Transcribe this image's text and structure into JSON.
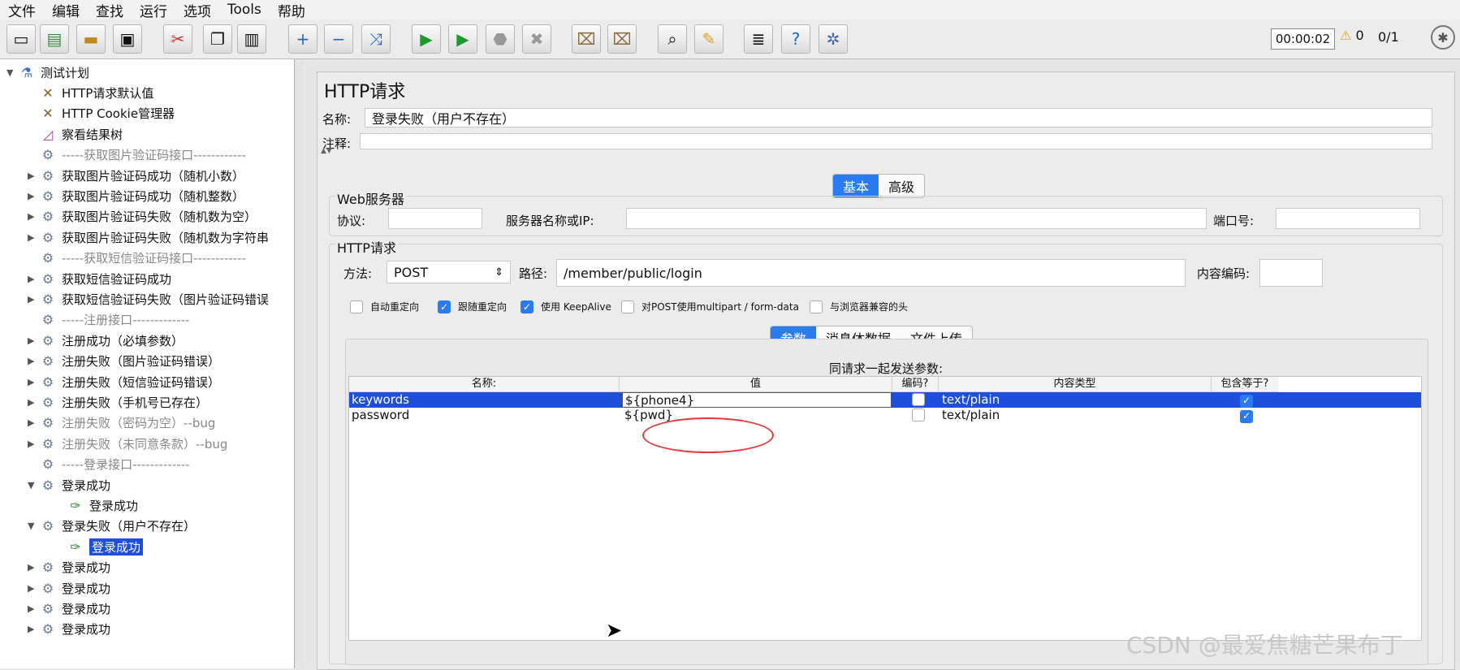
{
  "menu": [
    "文件",
    "编辑",
    "查找",
    "运行",
    "选项",
    "Tools",
    "帮助"
  ],
  "toolbar": {
    "icons": [
      "new-icon",
      "templates-icon",
      "open-icon",
      "save-icon",
      "cut-icon",
      "copy-icon",
      "paste-icon",
      "expand-icon",
      "collapse-icon",
      "toggle-icon",
      "start-icon",
      "start-no-pause-icon",
      "stop-icon",
      "shutdown-icon",
      "clear-icon",
      "clear-all-icon",
      "search-icon",
      "reset-search-icon",
      "function-helper-icon",
      "help-icon",
      "remote-icon"
    ],
    "timer": "00:00:02",
    "warn_count": "0",
    "threads": "0/1"
  },
  "tree": [
    {
      "label": "测试计划",
      "arrow": "▼",
      "icon": "flask-icon",
      "indent": 0,
      "dim": false
    },
    {
      "label": "HTTP请求默认值",
      "arrow": "",
      "icon": "wrench-icon",
      "indent": 1,
      "dim": false
    },
    {
      "label": "HTTP Cookie管理器",
      "arrow": "",
      "icon": "wrench-icon",
      "indent": 1,
      "dim": false
    },
    {
      "label": "察看结果树",
      "arrow": "",
      "icon": "chart-icon",
      "indent": 1,
      "dim": false
    },
    {
      "label": "-----获取图片验证码接口------------",
      "arrow": "",
      "icon": "gear-icon",
      "indent": 1,
      "dim": true
    },
    {
      "label": "获取图片验证码成功（随机小数）",
      "arrow": "▶",
      "icon": "gear-icon",
      "indent": 1,
      "dim": false
    },
    {
      "label": "获取图片验证码成功（随机整数）",
      "arrow": "▶",
      "icon": "gear-icon",
      "indent": 1,
      "dim": false
    },
    {
      "label": "获取图片验证码失败（随机数为空）",
      "arrow": "▶",
      "icon": "gear-icon",
      "indent": 1,
      "dim": false
    },
    {
      "label": "获取图片验证码失败（随机数为字符串",
      "arrow": "▶",
      "icon": "gear-icon",
      "indent": 1,
      "dim": false
    },
    {
      "label": "-----获取短信验证码接口------------",
      "arrow": "",
      "icon": "gear-icon",
      "indent": 1,
      "dim": true
    },
    {
      "label": "获取短信验证码成功",
      "arrow": "▶",
      "icon": "gear-icon",
      "indent": 1,
      "dim": false
    },
    {
      "label": "获取短信验证码失败（图片验证码错误",
      "arrow": "▶",
      "icon": "gear-icon",
      "indent": 1,
      "dim": false
    },
    {
      "label": "-----注册接口-------------",
      "arrow": "",
      "icon": "gear-icon",
      "indent": 1,
      "dim": true
    },
    {
      "label": "注册成功（必填参数）",
      "arrow": "▶",
      "icon": "gear-icon",
      "indent": 1,
      "dim": false
    },
    {
      "label": "注册失败（图片验证码错误）",
      "arrow": "▶",
      "icon": "gear-icon",
      "indent": 1,
      "dim": false
    },
    {
      "label": "注册失败（短信验证码错误）",
      "arrow": "▶",
      "icon": "gear-icon",
      "indent": 1,
      "dim": false
    },
    {
      "label": "注册失败（手机号已存在）",
      "arrow": "▶",
      "icon": "gear-icon",
      "indent": 1,
      "dim": false
    },
    {
      "label": "注册失败（密码为空）--bug",
      "arrow": "▶",
      "icon": "gear-icon",
      "indent": 1,
      "dim": true
    },
    {
      "label": "注册失败（未同意条款）--bug",
      "arrow": "▶",
      "icon": "gear-icon",
      "indent": 1,
      "dim": true
    },
    {
      "label": "-----登录接口-------------",
      "arrow": "",
      "icon": "gear-icon",
      "indent": 1,
      "dim": true
    },
    {
      "label": "登录成功",
      "arrow": "▼",
      "icon": "gear-icon",
      "indent": 1,
      "dim": false
    },
    {
      "label": "登录成功",
      "arrow": "",
      "icon": "pipette-icon",
      "indent": 2,
      "dim": false
    },
    {
      "label": "登录失败（用户不存在）",
      "arrow": "▼",
      "icon": "gear-icon",
      "indent": 1,
      "dim": false
    },
    {
      "label": "登录成功",
      "arrow": "",
      "icon": "pipette-icon",
      "indent": 2,
      "dim": false,
      "selected": true
    },
    {
      "label": "登录成功",
      "arrow": "▶",
      "icon": "gear-icon",
      "indent": 1,
      "dim": false
    },
    {
      "label": "登录成功",
      "arrow": "▶",
      "icon": "gear-icon",
      "indent": 1,
      "dim": false
    },
    {
      "label": "登录成功",
      "arrow": "▶",
      "icon": "gear-icon",
      "indent": 1,
      "dim": false
    },
    {
      "label": "登录成功",
      "arrow": "▶",
      "icon": "gear-icon",
      "indent": 1,
      "dim": false
    }
  ],
  "panel": {
    "title": "HTTP请求",
    "name_label": "名称:",
    "name_value": "登录失败（用户不存在）",
    "comment_label": "注释:",
    "comment_value": "",
    "tabs": {
      "basic": "基本",
      "advanced": "高级"
    },
    "web_group": "Web服务器",
    "protocol_label": "协议:",
    "protocol_value": "",
    "server_label": "服务器名称或IP:",
    "server_value": "",
    "port_label": "端口号:",
    "port_value": "",
    "http_group": "HTTP请求",
    "method_label": "方法:",
    "method_value": "POST",
    "path_label": "路径:",
    "path_value": "/member/public/login",
    "encoding_label": "内容编码:",
    "encoding_value": "",
    "checkboxes": [
      {
        "label": "自动重定向",
        "checked": false
      },
      {
        "label": "跟随重定向",
        "checked": true
      },
      {
        "label": "使用 KeepAlive",
        "checked": true
      },
      {
        "label": "对POST使用multipart / form-data",
        "checked": false
      },
      {
        "label": "与浏览器兼容的头",
        "checked": false
      }
    ],
    "subtabs": {
      "params": "参数",
      "body": "消息体数据",
      "files": "文件上传"
    },
    "table_caption": "同请求一起发送参数:",
    "columns": [
      "名称:",
      "值",
      "编码?",
      "内容类型",
      "包含等于?"
    ],
    "rows": [
      {
        "name": "keywords",
        "value": "${phone4}",
        "encode": false,
        "type": "text/plain",
        "include_equals": true,
        "selected": true
      },
      {
        "name": "password",
        "value": "${pwd}",
        "encode": false,
        "type": "text/plain",
        "include_equals": true,
        "selected": false
      }
    ]
  },
  "watermark": "CSDN @最爱焦糖芒果布丁"
}
